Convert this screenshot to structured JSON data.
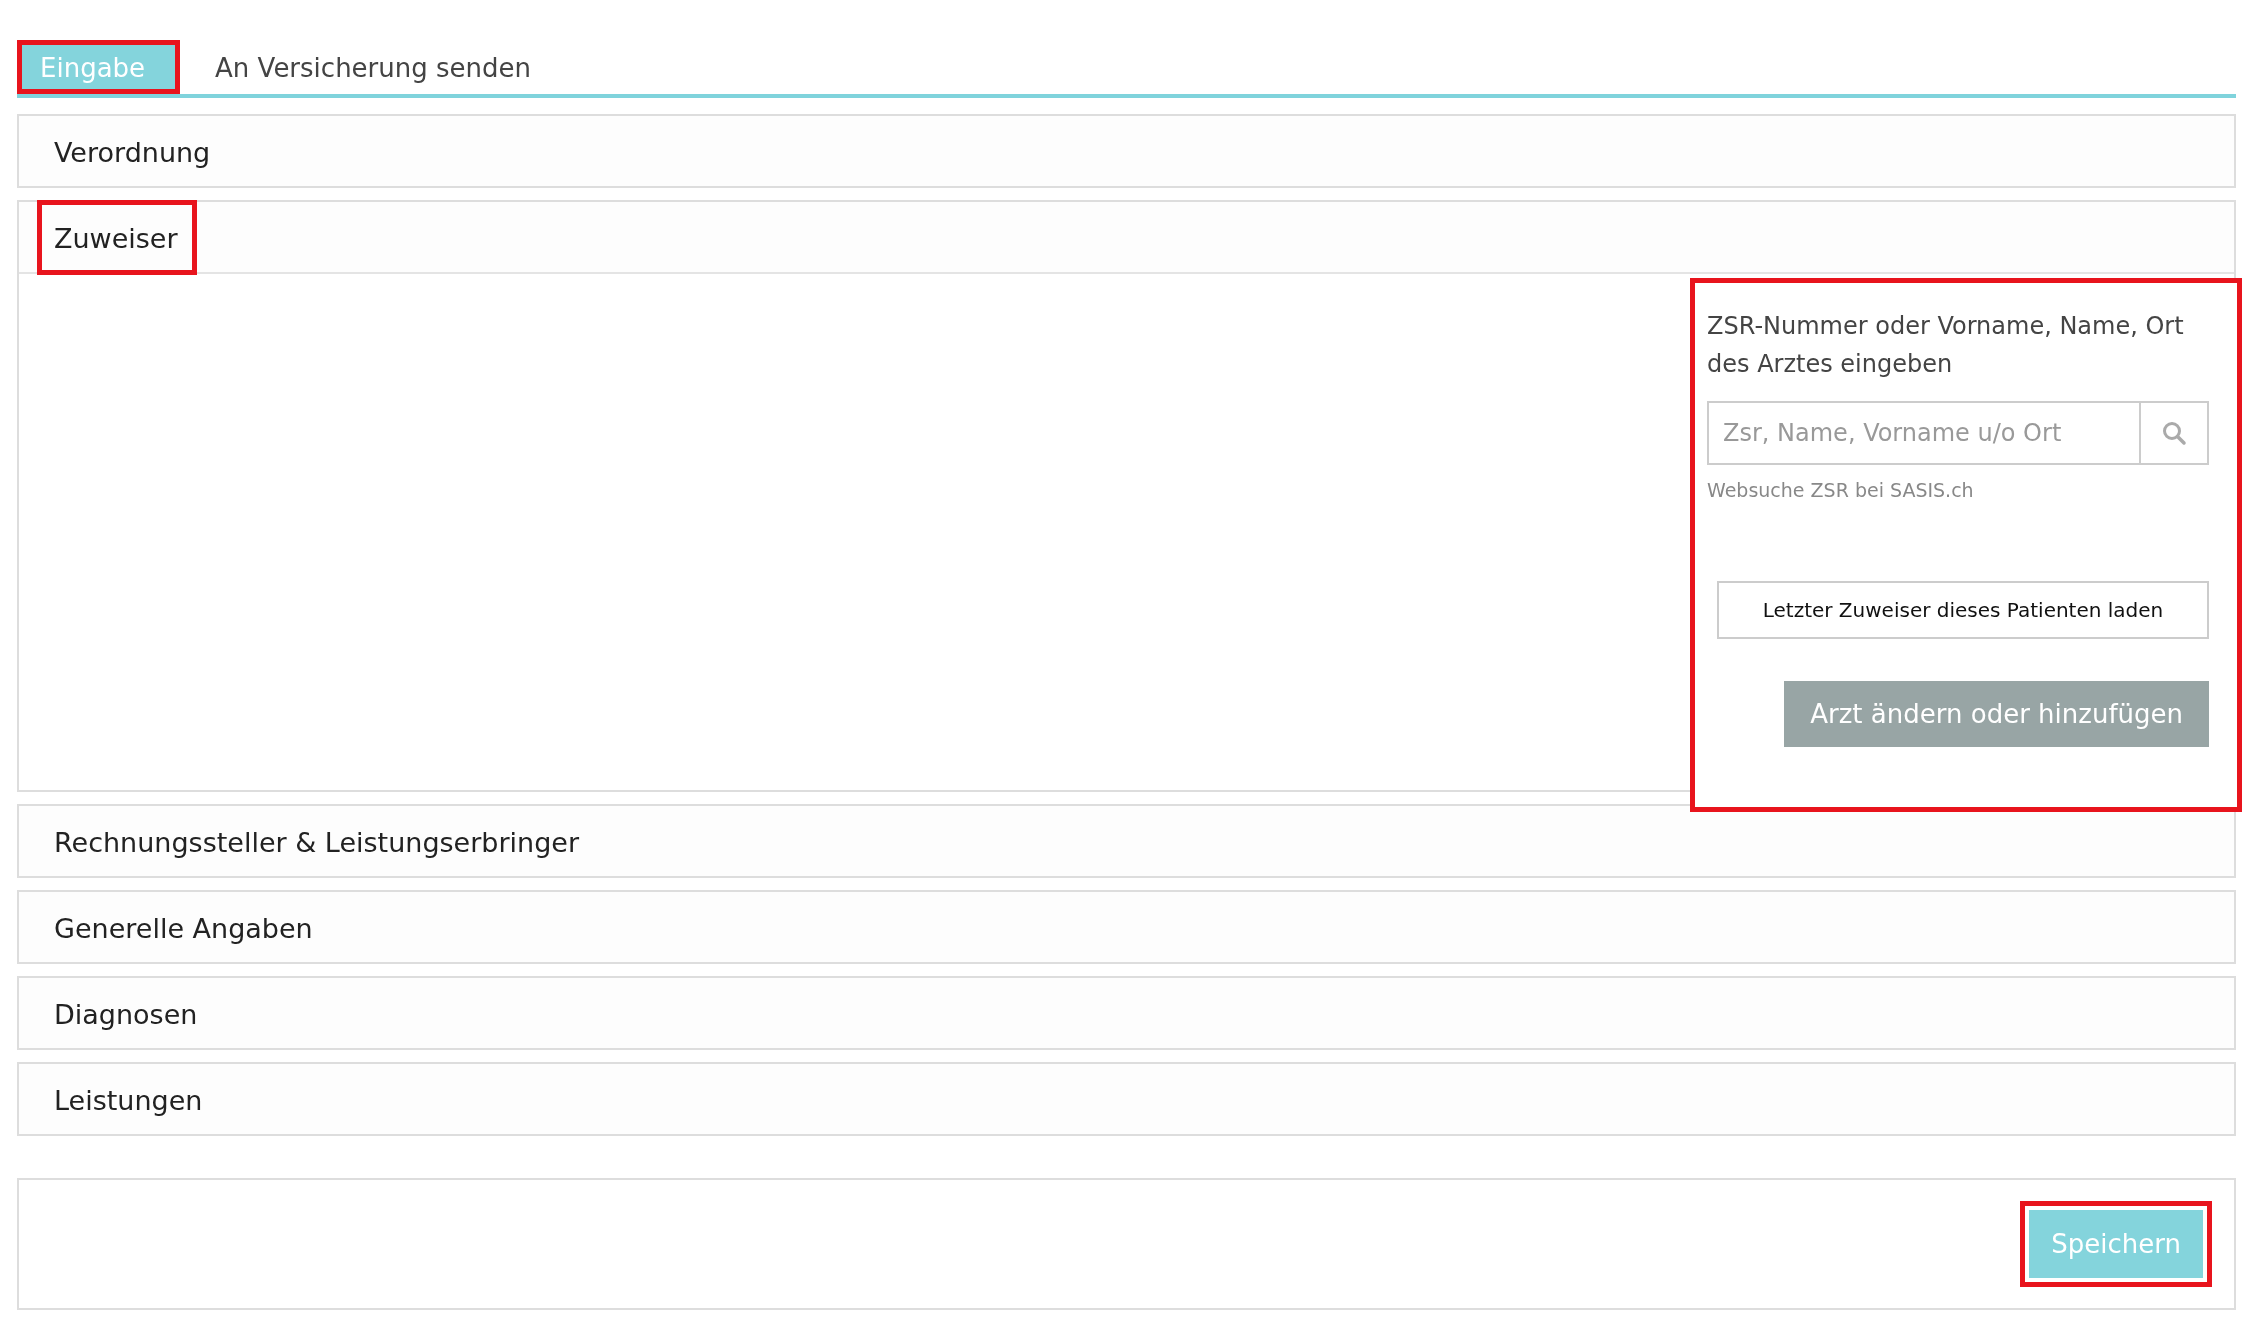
{
  "tabs": [
    {
      "label": "Eingabe",
      "selected": true,
      "highlighted": true
    },
    {
      "label": "An Versicherung senden",
      "selected": false,
      "highlighted": false
    }
  ],
  "sections": [
    {
      "title": "Verordnung",
      "highlighted": false
    },
    {
      "title": "Zuweiser",
      "highlighted": true,
      "body": {
        "highlighted": true,
        "instruction": "ZSR-Nummer oder Vorname, Name, Ort des Arztes eingeben",
        "search": {
          "placeholder": "Zsr, Name, Vorname u/o Ort"
        },
        "link": "Websuche ZSR bei SASIS.ch",
        "load_button": "Letzter Zuweiser dieses Patienten laden",
        "edit_button": "Arzt ändern oder hinzufügen"
      }
    },
    {
      "title": "Rechnungssteller & Leistungserbringer",
      "highlighted": false
    },
    {
      "title": "Generelle Angaben",
      "highlighted": false
    },
    {
      "title": "Diagnosen",
      "highlighted": false
    },
    {
      "title": "Leistungen",
      "highlighted": false
    }
  ],
  "save_button": {
    "label": "Speichern",
    "highlighted": true
  }
}
